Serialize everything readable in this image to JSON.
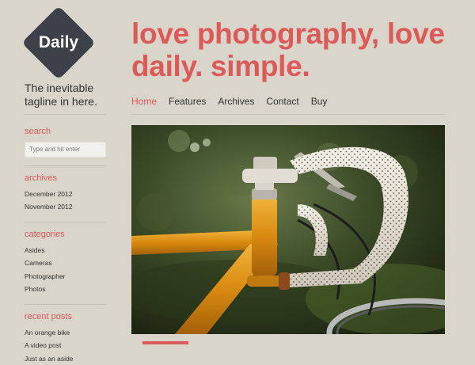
{
  "logo": {
    "text": "Daily"
  },
  "tagline": "The inevitable tagline in here.",
  "headline": "love photography, love daily. simple.",
  "nav": [
    {
      "label": "Home",
      "active": true
    },
    {
      "label": "Features"
    },
    {
      "label": "Archives"
    },
    {
      "label": "Contact"
    },
    {
      "label": "Buy"
    }
  ],
  "sidebar": {
    "search": {
      "title": "search",
      "placeholder": "Type and hit enter"
    },
    "archives": {
      "title": "archives",
      "items": [
        "December 2012",
        "November 2012"
      ]
    },
    "categories": {
      "title": "categories",
      "items": [
        "Asides",
        "Cameras",
        "Photographer",
        "Photos"
      ]
    },
    "recent_posts": {
      "title": "recent posts",
      "items": [
        "An orange bike",
        "A video post",
        "Just as an aside"
      ]
    }
  },
  "colors": {
    "accent": "#dc5a58",
    "background": "#d9d5cb",
    "logo": "#3c4048"
  },
  "featured_image": {
    "subject": "orange-bicycle-handlebars"
  }
}
